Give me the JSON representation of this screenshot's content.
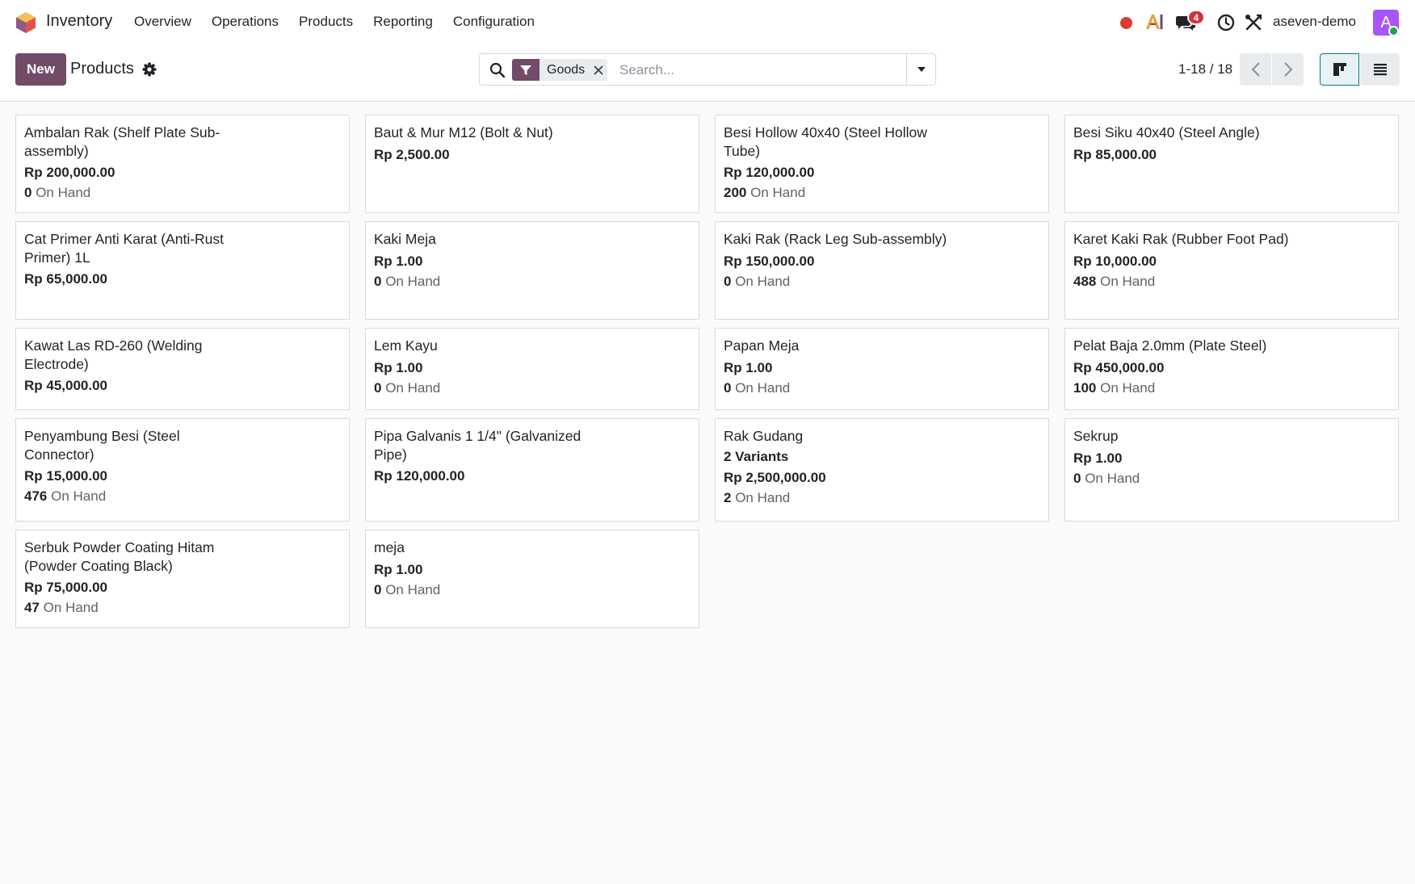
{
  "navbar": {
    "app_name": "Inventory",
    "menu": [
      "Overview",
      "Operations",
      "Products",
      "Reporting",
      "Configuration"
    ],
    "chat_badge": "4",
    "user_name": "aseven-demo",
    "avatar_letter": "A"
  },
  "control_panel": {
    "new_label": "New",
    "breadcrumb": "Products",
    "facet_label": "Goods",
    "search_placeholder": "Search...",
    "pager": "1-18 / 18"
  },
  "colors": {
    "brand": "#714b67",
    "accent": "#017e84",
    "badge": "#d6303a",
    "record": "#dc3b2f",
    "avatar": "#a855f7"
  },
  "products": [
    {
      "name": "Ambalan Rak (Shelf Plate Sub-assembly)",
      "price": "Rp 200,000.00",
      "qty": "0",
      "unit": "On Hand"
    },
    {
      "name": "Baut & Mur M12 (Bolt & Nut)",
      "price": "Rp 2,500.00"
    },
    {
      "name": "Besi Hollow 40x40 (Steel Hollow Tube)",
      "price": "Rp 120,000.00",
      "qty": "200",
      "unit": "On Hand"
    },
    {
      "name": "Besi Siku 40x40 (Steel Angle)",
      "price": "Rp 85,000.00"
    },
    {
      "name": "Cat Primer Anti Karat (Anti-Rust Primer) 1L",
      "price": "Rp 65,000.00"
    },
    {
      "name": "Kaki Meja",
      "price": "Rp 1.00",
      "qty": "0",
      "unit": "On Hand"
    },
    {
      "name": "Kaki Rak (Rack Leg Sub-assembly)",
      "price": "Rp 150,000.00",
      "qty": "0",
      "unit": "On Hand"
    },
    {
      "name": "Karet Kaki Rak (Rubber Foot Pad)",
      "price": "Rp 10,000.00",
      "qty": "488",
      "unit": "On Hand"
    },
    {
      "name": "Kawat Las RD-260 (Welding Electrode)",
      "price": "Rp 45,000.00"
    },
    {
      "name": "Lem Kayu",
      "price": "Rp 1.00",
      "qty": "0",
      "unit": "On Hand"
    },
    {
      "name": "Papan Meja",
      "price": "Rp 1.00",
      "qty": "0",
      "unit": "On Hand"
    },
    {
      "name": "Pelat Baja 2.0mm (Plate Steel)",
      "price": "Rp 450,000.00",
      "qty": "100",
      "unit": "On Hand"
    },
    {
      "name": "Penyambung Besi (Steel Connector)",
      "price": "Rp 15,000.00",
      "qty": "476",
      "unit": "On Hand"
    },
    {
      "name": "Pipa Galvanis 1 1/4\" (Galvanized Pipe)",
      "price": "Rp 120,000.00"
    },
    {
      "name": "Rak Gudang",
      "variants": "2 Variants",
      "price": "Rp 2,500,000.00",
      "qty": "2",
      "unit": "On Hand"
    },
    {
      "name": "Sekrup",
      "price": "Rp 1.00",
      "qty": "0",
      "unit": "On Hand"
    },
    {
      "name": "Serbuk Powder Coating Hitam (Powder Coating Black)",
      "price": "Rp 75,000.00",
      "qty": "47",
      "unit": "On Hand"
    },
    {
      "name": "meja",
      "price": "Rp 1.00",
      "qty": "0",
      "unit": "On Hand"
    }
  ]
}
